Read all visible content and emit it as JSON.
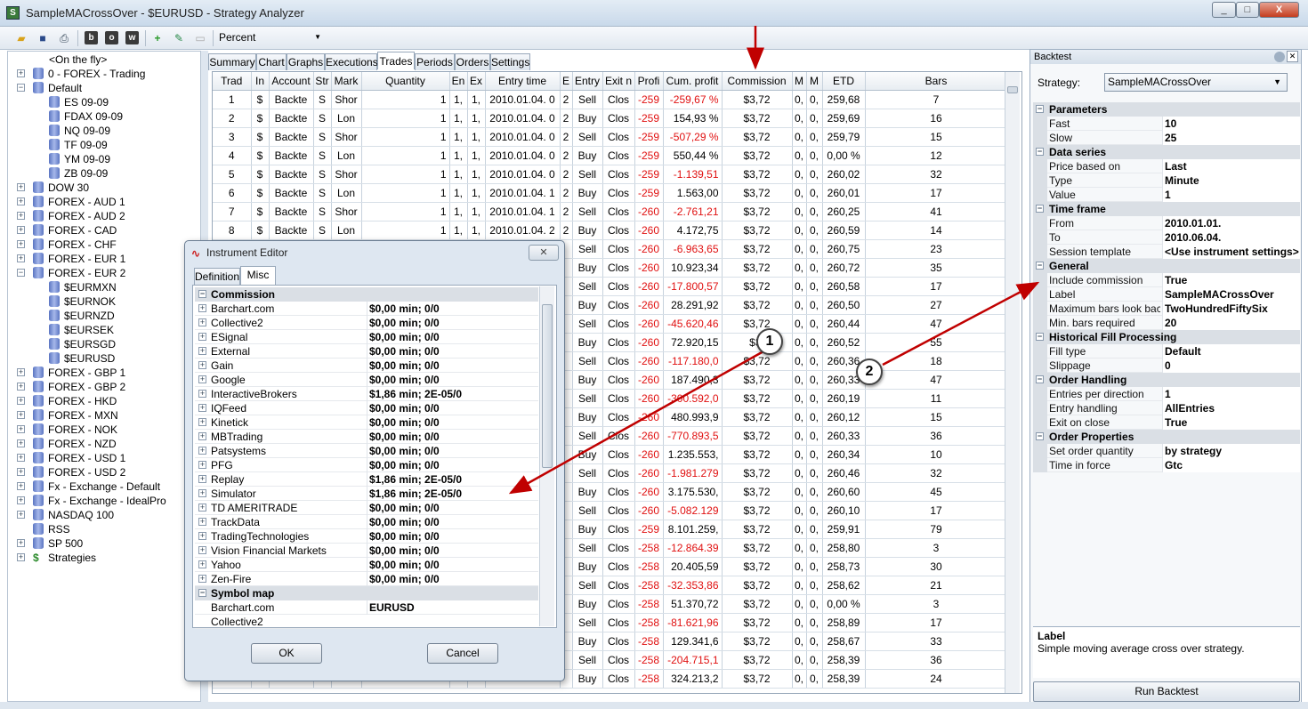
{
  "window": {
    "title": "SampleMACrossOver - $EURUSD - Strategy Analyzer",
    "min": "_",
    "max": "□",
    "close": "X"
  },
  "toolbar": {
    "display_unit": "Percent",
    "icons": [
      "open-folder-icon",
      "save-icon",
      "print-icon",
      "b-icon",
      "o-icon",
      "w-icon",
      "add-icon",
      "edit-icon",
      "delete-icon"
    ]
  },
  "tree": [
    {
      "label": "<On the fly>",
      "level": 1,
      "exp": ""
    },
    {
      "label": "0 - FOREX - Trading",
      "level": 0,
      "exp": "+"
    },
    {
      "label": "Default",
      "level": 0,
      "exp": "−"
    },
    {
      "label": "ES 09-09",
      "level": 1,
      "exp": ""
    },
    {
      "label": "FDAX 09-09",
      "level": 1,
      "exp": ""
    },
    {
      "label": "NQ 09-09",
      "level": 1,
      "exp": ""
    },
    {
      "label": "TF 09-09",
      "level": 1,
      "exp": ""
    },
    {
      "label": "YM 09-09",
      "level": 1,
      "exp": ""
    },
    {
      "label": "ZB 09-09",
      "level": 1,
      "exp": ""
    },
    {
      "label": "DOW 30",
      "level": 0,
      "exp": "+"
    },
    {
      "label": "FOREX - AUD 1",
      "level": 0,
      "exp": "+"
    },
    {
      "label": "FOREX - AUD 2",
      "level": 0,
      "exp": "+"
    },
    {
      "label": "FOREX - CAD",
      "level": 0,
      "exp": "+"
    },
    {
      "label": "FOREX - CHF",
      "level": 0,
      "exp": "+"
    },
    {
      "label": "FOREX - EUR 1",
      "level": 0,
      "exp": "+"
    },
    {
      "label": "FOREX - EUR 2",
      "level": 0,
      "exp": "−"
    },
    {
      "label": "$EURMXN",
      "level": 1,
      "exp": ""
    },
    {
      "label": "$EURNOK",
      "level": 1,
      "exp": ""
    },
    {
      "label": "$EURNZD",
      "level": 1,
      "exp": ""
    },
    {
      "label": "$EURSEK",
      "level": 1,
      "exp": ""
    },
    {
      "label": "$EURSGD",
      "level": 1,
      "exp": ""
    },
    {
      "label": "$EURUSD",
      "level": 1,
      "exp": ""
    },
    {
      "label": "FOREX - GBP 1",
      "level": 0,
      "exp": "+"
    },
    {
      "label": "FOREX - GBP 2",
      "level": 0,
      "exp": "+"
    },
    {
      "label": "FOREX - HKD",
      "level": 0,
      "exp": "+"
    },
    {
      "label": "FOREX - MXN",
      "level": 0,
      "exp": "+"
    },
    {
      "label": "FOREX - NOK",
      "level": 0,
      "exp": "+"
    },
    {
      "label": "FOREX - NZD",
      "level": 0,
      "exp": "+"
    },
    {
      "label": "FOREX - USD 1",
      "level": 0,
      "exp": "+"
    },
    {
      "label": "FOREX - USD 2",
      "level": 0,
      "exp": "+"
    },
    {
      "label": "Fx - Exchange - Default",
      "level": 0,
      "exp": "+"
    },
    {
      "label": "Fx - Exchange - IdealPro",
      "level": 0,
      "exp": "+"
    },
    {
      "label": "NASDAQ 100",
      "level": 0,
      "exp": "+"
    },
    {
      "label": "RSS",
      "level": 0,
      "exp": ""
    },
    {
      "label": "SP 500",
      "level": 0,
      "exp": "+"
    },
    {
      "label": "Strategies",
      "level": 0,
      "exp": "+"
    }
  ],
  "tabs": [
    "Summary",
    "Chart",
    "Graphs",
    "Executions",
    "Trades",
    "Periods",
    "Orders",
    "Settings"
  ],
  "active_tab": "Trades",
  "columns": [
    "Trad",
    "In",
    "Account",
    "Str",
    "Mark",
    "Quantity",
    "En",
    "Ex",
    "Entry time",
    "E",
    "Entry",
    "Exit n",
    "Profi",
    "Cum. profit",
    "Commission",
    "M",
    "M",
    "ETD",
    "Bars"
  ],
  "rows": [
    [
      "1",
      "$",
      "Backte",
      "S",
      "Shor",
      "1",
      "1,",
      "1,",
      "2010.01.04. 0",
      "2",
      "Sell",
      "Clos",
      "-259",
      "-259,67 %",
      "$3,72",
      "0,",
      "0,",
      "259,68",
      "7"
    ],
    [
      "2",
      "$",
      "Backte",
      "S",
      "Lon",
      "1",
      "1,",
      "1,",
      "2010.01.04. 0",
      "2",
      "Buy",
      "Clos",
      "-259",
      "154,93 %",
      "$3,72",
      "0,",
      "0,",
      "259,69",
      "16"
    ],
    [
      "3",
      "$",
      "Backte",
      "S",
      "Shor",
      "1",
      "1,",
      "1,",
      "2010.01.04. 0",
      "2",
      "Sell",
      "Clos",
      "-259",
      "-507,29 %",
      "$3,72",
      "0,",
      "0,",
      "259,79",
      "15"
    ],
    [
      "4",
      "$",
      "Backte",
      "S",
      "Lon",
      "1",
      "1,",
      "1,",
      "2010.01.04. 0",
      "2",
      "Buy",
      "Clos",
      "-259",
      "550,44 %",
      "$3,72",
      "0,",
      "0,",
      "0,00 %",
      "12"
    ],
    [
      "5",
      "$",
      "Backte",
      "S",
      "Shor",
      "1",
      "1,",
      "1,",
      "2010.01.04. 0",
      "2",
      "Sell",
      "Clos",
      "-259",
      "-1.139,51",
      "$3,72",
      "0,",
      "0,",
      "260,02",
      "32"
    ],
    [
      "6",
      "$",
      "Backte",
      "S",
      "Lon",
      "1",
      "1,",
      "1,",
      "2010.01.04. 1",
      "2",
      "Buy",
      "Clos",
      "-259",
      "1.563,00",
      "$3,72",
      "0,",
      "0,",
      "260,01",
      "17"
    ],
    [
      "7",
      "$",
      "Backte",
      "S",
      "Shor",
      "1",
      "1,",
      "1,",
      "2010.01.04. 1",
      "2",
      "Sell",
      "Clos",
      "-260",
      "-2.761,21",
      "$3,72",
      "0,",
      "0,",
      "260,25",
      "41"
    ],
    [
      "8",
      "$",
      "Backte",
      "S",
      "Lon",
      "1",
      "1,",
      "1,",
      "2010.01.04. 2",
      "2",
      "Buy",
      "Clos",
      "-260",
      "4.172,75",
      "$3,72",
      "0,",
      "0,",
      "260,59",
      "14"
    ],
    [
      "",
      "",
      "",
      "",
      "",
      "",
      "",
      "",
      "",
      "",
      "Sell",
      "Clos",
      "-260",
      "-6.963,65",
      "$3,72",
      "0,",
      "0,",
      "260,75",
      "23"
    ],
    [
      "",
      "",
      "",
      "",
      "",
      "",
      "",
      "",
      "",
      "",
      "Buy",
      "Clos",
      "-260",
      "10.923,34",
      "$3,72",
      "0,",
      "0,",
      "260,72",
      "35"
    ],
    [
      "",
      "",
      "",
      "",
      "",
      "",
      "",
      "",
      "",
      "",
      "Sell",
      "Clos",
      "-260",
      "-17.800,57",
      "$3,72",
      "0,",
      "0,",
      "260,58",
      "17"
    ],
    [
      "",
      "",
      "",
      "",
      "",
      "",
      "",
      "",
      "",
      "",
      "Buy",
      "Clos",
      "-260",
      "28.291,92",
      "$3,72",
      "0,",
      "0,",
      "260,50",
      "27"
    ],
    [
      "",
      "",
      "",
      "",
      "",
      "",
      "",
      "",
      "",
      "",
      "Sell",
      "Clos",
      "-260",
      "-45.620,46",
      "$3,72",
      "0,",
      "0,",
      "260,44",
      "47"
    ],
    [
      "",
      "",
      "",
      "",
      "",
      "",
      "",
      "",
      "",
      "",
      "Buy",
      "Clos",
      "-260",
      "72.920,15",
      "$3,",
      "0,",
      "0,",
      "260,52",
      "55"
    ],
    [
      "",
      "",
      "",
      "",
      "",
      "",
      "",
      "",
      "",
      "",
      "Sell",
      "Clos",
      "-260",
      "-117.180,0",
      "$3,72",
      "0,",
      "0,",
      "260,36",
      "18"
    ],
    [
      "",
      "",
      "",
      "",
      "",
      "",
      "",
      "",
      "",
      "",
      "Buy",
      "Clos",
      "-260",
      "187.490,3",
      "$3,72",
      "0,",
      "0,",
      "260,33",
      "47"
    ],
    [
      "",
      "",
      "",
      "",
      "",
      "",
      "",
      "",
      "",
      "",
      "Sell",
      "Clos",
      "-260",
      "-300.592,0",
      "$3,72",
      "0,",
      "0,",
      "260,19",
      "11"
    ],
    [
      "",
      "",
      "",
      "",
      "",
      "",
      "",
      "",
      "",
      "",
      "Buy",
      "Clos",
      "-260",
      "480.993,9",
      "$3,72",
      "0,",
      "0,",
      "260,12",
      "15"
    ],
    [
      "",
      "",
      "",
      "",
      "",
      "",
      "",
      "",
      "",
      "",
      "Sell",
      "Clos",
      "-260",
      "-770.893,5",
      "$3,72",
      "0,",
      "0,",
      "260,33",
      "36"
    ],
    [
      "",
      "",
      "",
      "",
      "",
      "",
      "",
      "",
      "",
      "",
      "Buy",
      "Clos",
      "-260",
      "1.235.553,",
      "$3,72",
      "0,",
      "0,",
      "260,34",
      "10"
    ],
    [
      "",
      "",
      "",
      "",
      "",
      "",
      "",
      "",
      "",
      "",
      "Sell",
      "Clos",
      "-260",
      "-1.981.279",
      "$3,72",
      "0,",
      "0,",
      "260,46",
      "32"
    ],
    [
      "",
      "",
      "",
      "",
      "",
      "",
      "",
      "",
      "",
      "",
      "Buy",
      "Clos",
      "-260",
      "3.175.530,",
      "$3,72",
      "0,",
      "0,",
      "260,60",
      "45"
    ],
    [
      "",
      "",
      "",
      "",
      "",
      "",
      "",
      "",
      "",
      "",
      "Sell",
      "Clos",
      "-260",
      "-5.082.129",
      "$3,72",
      "0,",
      "0,",
      "260,10",
      "17"
    ],
    [
      "",
      "",
      "",
      "",
      "",
      "",
      "",
      "",
      "",
      "",
      "Buy",
      "Clos",
      "-259",
      "8.101.259,",
      "$3,72",
      "0,",
      "0,",
      "259,91",
      "79"
    ],
    [
      "",
      "",
      "",
      "",
      "",
      "",
      "",
      "",
      "",
      "",
      "Sell",
      "Clos",
      "-258",
      "-12.864.39",
      "$3,72",
      "0,",
      "0,",
      "258,80",
      "3"
    ],
    [
      "",
      "",
      "",
      "",
      "",
      "",
      "",
      "",
      "",
      "",
      "Buy",
      "Clos",
      "-258",
      "20.405,59",
      "$3,72",
      "0,",
      "0,",
      "258,73",
      "30"
    ],
    [
      "",
      "",
      "",
      "",
      "",
      "",
      "",
      "",
      "",
      "",
      "Sell",
      "Clos",
      "-258",
      "-32.353,86",
      "$3,72",
      "0,",
      "0,",
      "258,62",
      "21"
    ],
    [
      "",
      "",
      "",
      "",
      "",
      "",
      "",
      "",
      "",
      "",
      "Buy",
      "Clos",
      "-258",
      "51.370,72",
      "$3,72",
      "0,",
      "0,",
      "0,00 %",
      "3"
    ],
    [
      "",
      "",
      "",
      "",
      "",
      "",
      "",
      "",
      "",
      "",
      "Sell",
      "Clos",
      "-258",
      "-81.621,96",
      "$3,72",
      "0,",
      "0,",
      "258,89",
      "17"
    ],
    [
      "",
      "",
      "",
      "",
      "",
      "",
      "",
      "",
      "",
      "",
      "Buy",
      "Clos",
      "-258",
      "129.341,6",
      "$3,72",
      "0,",
      "0,",
      "258,67",
      "33"
    ],
    [
      "",
      "",
      "",
      "",
      "",
      "",
      "",
      "",
      "",
      "",
      "Sell",
      "Clos",
      "-258",
      "-204.715,1",
      "$3,72",
      "0,",
      "0,",
      "258,39",
      "36"
    ],
    [
      "",
      "",
      "",
      "",
      "",
      "",
      "",
      "",
      "",
      "",
      "Buy",
      "Clos",
      "-258",
      "324.213,2",
      "$3,72",
      "0,",
      "0,",
      "258,39",
      "24"
    ]
  ],
  "backtest": {
    "header": "Backtest",
    "strategy_label": "Strategy:",
    "strategy_value": "SampleMACrossOver",
    "sections": [
      {
        "title": "Parameters",
        "props": [
          [
            "Fast",
            "10"
          ],
          [
            "Slow",
            "25"
          ]
        ]
      },
      {
        "title": "Data series",
        "props": [
          [
            "Price based on",
            "Last"
          ],
          [
            "Type",
            "Minute"
          ],
          [
            "Value",
            "1"
          ]
        ]
      },
      {
        "title": "Time frame",
        "props": [
          [
            "From",
            "2010.01.01."
          ],
          [
            "To",
            "2010.06.04."
          ],
          [
            "Session template",
            "<Use instrument settings>"
          ]
        ]
      },
      {
        "title": "General",
        "props": [
          [
            "Include commission",
            "True"
          ],
          [
            "Label",
            "SampleMACrossOver"
          ],
          [
            "Maximum bars look back",
            "TwoHundredFiftySix"
          ],
          [
            "Min. bars required",
            "20"
          ]
        ]
      },
      {
        "title": "Historical Fill Processing",
        "props": [
          [
            "Fill type",
            "Default"
          ],
          [
            "Slippage",
            "0"
          ]
        ]
      },
      {
        "title": "Order Handling",
        "props": [
          [
            "Entries per direction",
            "1"
          ],
          [
            "Entry handling",
            "AllEntries"
          ],
          [
            "Exit on close",
            "True"
          ]
        ]
      },
      {
        "title": "Order Properties",
        "props": [
          [
            "Set order quantity",
            "by strategy"
          ],
          [
            "Time in force",
            "Gtc"
          ]
        ]
      }
    ],
    "desc_title": "Label",
    "desc_text": "Simple moving average cross over strategy.",
    "run_button": "Run Backtest"
  },
  "instrument_editor": {
    "title": "Instrument Editor",
    "tabs": [
      "Definition",
      "Misc"
    ],
    "active_tab": "Misc",
    "commission_title": "Commission",
    "commission": [
      [
        "Barchart.com",
        "$0,00 min;  0/0"
      ],
      [
        "Collective2",
        "$0,00 min;  0/0"
      ],
      [
        "ESignal",
        "$0,00 min;  0/0"
      ],
      [
        "External",
        "$0,00 min;  0/0"
      ],
      [
        "Gain",
        "$0,00 min;  0/0"
      ],
      [
        "Google",
        "$0,00 min;  0/0"
      ],
      [
        "InteractiveBrokers",
        "$1,86 min; 2E-05/0"
      ],
      [
        "IQFeed",
        "$0,00 min;  0/0"
      ],
      [
        "Kinetick",
        "$0,00 min;  0/0"
      ],
      [
        "MBTrading",
        "$0,00 min;  0/0"
      ],
      [
        "Patsystems",
        "$0,00 min;  0/0"
      ],
      [
        "PFG",
        "$0,00 min;  0/0"
      ],
      [
        "Replay",
        "$1,86 min; 2E-05/0"
      ],
      [
        "Simulator",
        "$1,86 min; 2E-05/0"
      ],
      [
        "TD AMERITRADE",
        "$0,00 min;  0/0"
      ],
      [
        "TrackData",
        "$0,00 min;  0/0"
      ],
      [
        "TradingTechnologies",
        "$0,00 min;  0/0"
      ],
      [
        "Vision Financial Markets",
        "$0,00 min;  0/0"
      ],
      [
        "Yahoo",
        "$0,00 min;  0/0"
      ],
      [
        "Zen-Fire",
        "$0,00 min;  0/0"
      ]
    ],
    "symbol_map_title": "Symbol map",
    "symbol_map": [
      [
        "Barchart.com",
        "EURUSD"
      ],
      [
        "Collective2",
        ""
      ]
    ],
    "ok": "OK",
    "cancel": "Cancel"
  },
  "callouts": [
    "1",
    "2"
  ],
  "annotation_color": "#c00000"
}
